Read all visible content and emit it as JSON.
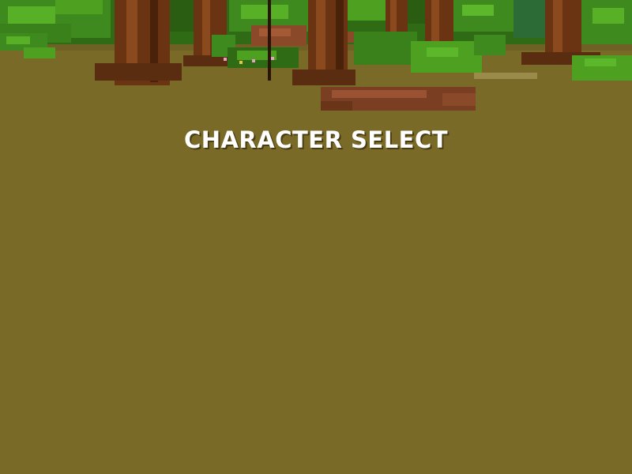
{
  "screen": {
    "title": "CHARACTER SELECT"
  },
  "colors": {
    "ground": "#7a6a28",
    "title_text": "#ffffff",
    "title_shadow": "#4a3c12"
  },
  "scene": {
    "background": "forest-edge",
    "elements": [
      "tree-trunk",
      "bush",
      "dirt-patch",
      "flower",
      "stick"
    ]
  }
}
